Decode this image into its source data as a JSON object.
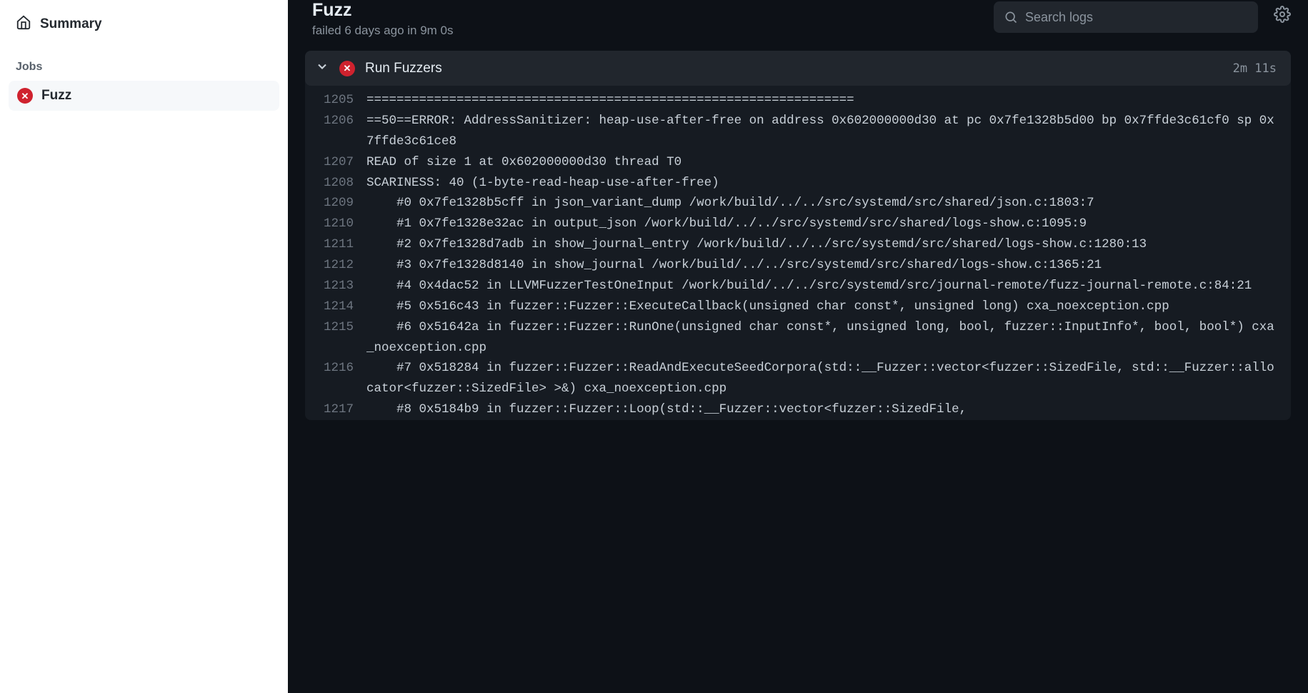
{
  "sidebar": {
    "summary_label": "Summary",
    "jobs_heading": "Jobs",
    "jobs": [
      {
        "name": "Fuzz",
        "status": "failed"
      }
    ]
  },
  "header": {
    "title": "Fuzz",
    "status_line": "failed 6 days ago in 9m 0s",
    "search_placeholder": "Search logs"
  },
  "step": {
    "title": "Run Fuzzers",
    "duration": "2m 11s",
    "status": "failed"
  },
  "log_lines": [
    {
      "n": "1205",
      "t": "================================================================="
    },
    {
      "n": "1206",
      "t": "==50==ERROR: AddressSanitizer: heap-use-after-free on address 0x602000000d30 at pc 0x7fe1328b5d00 bp 0x7ffde3c61cf0 sp 0x7ffde3c61ce8"
    },
    {
      "n": "1207",
      "t": "READ of size 1 at 0x602000000d30 thread T0"
    },
    {
      "n": "1208",
      "t": "SCARINESS: 40 (1-byte-read-heap-use-after-free)"
    },
    {
      "n": "1209",
      "t": "    #0 0x7fe1328b5cff in json_variant_dump /work/build/../../src/systemd/src/shared/json.c:1803:7"
    },
    {
      "n": "1210",
      "t": "    #1 0x7fe1328e32ac in output_json /work/build/../../src/systemd/src/shared/logs-show.c:1095:9"
    },
    {
      "n": "1211",
      "t": "    #2 0x7fe1328d7adb in show_journal_entry /work/build/../../src/systemd/src/shared/logs-show.c:1280:13"
    },
    {
      "n": "1212",
      "t": "    #3 0x7fe1328d8140 in show_journal /work/build/../../src/systemd/src/shared/logs-show.c:1365:21"
    },
    {
      "n": "1213",
      "t": "    #4 0x4dac52 in LLVMFuzzerTestOneInput /work/build/../../src/systemd/src/journal-remote/fuzz-journal-remote.c:84:21"
    },
    {
      "n": "1214",
      "t": "    #5 0x516c43 in fuzzer::Fuzzer::ExecuteCallback(unsigned char const*, unsigned long) cxa_noexception.cpp"
    },
    {
      "n": "1215",
      "t": "    #6 0x51642a in fuzzer::Fuzzer::RunOne(unsigned char const*, unsigned long, bool, fuzzer::InputInfo*, bool, bool*) cxa_noexception.cpp"
    },
    {
      "n": "1216",
      "t": "    #7 0x518284 in fuzzer::Fuzzer::ReadAndExecuteSeedCorpora(std::__Fuzzer::vector<fuzzer::SizedFile, std::__Fuzzer::allocator<fuzzer::SizedFile> >&) cxa_noexception.cpp"
    },
    {
      "n": "1217",
      "t": "    #8 0x5184b9 in fuzzer::Fuzzer::Loop(std::__Fuzzer::vector<fuzzer::SizedFile,"
    }
  ]
}
